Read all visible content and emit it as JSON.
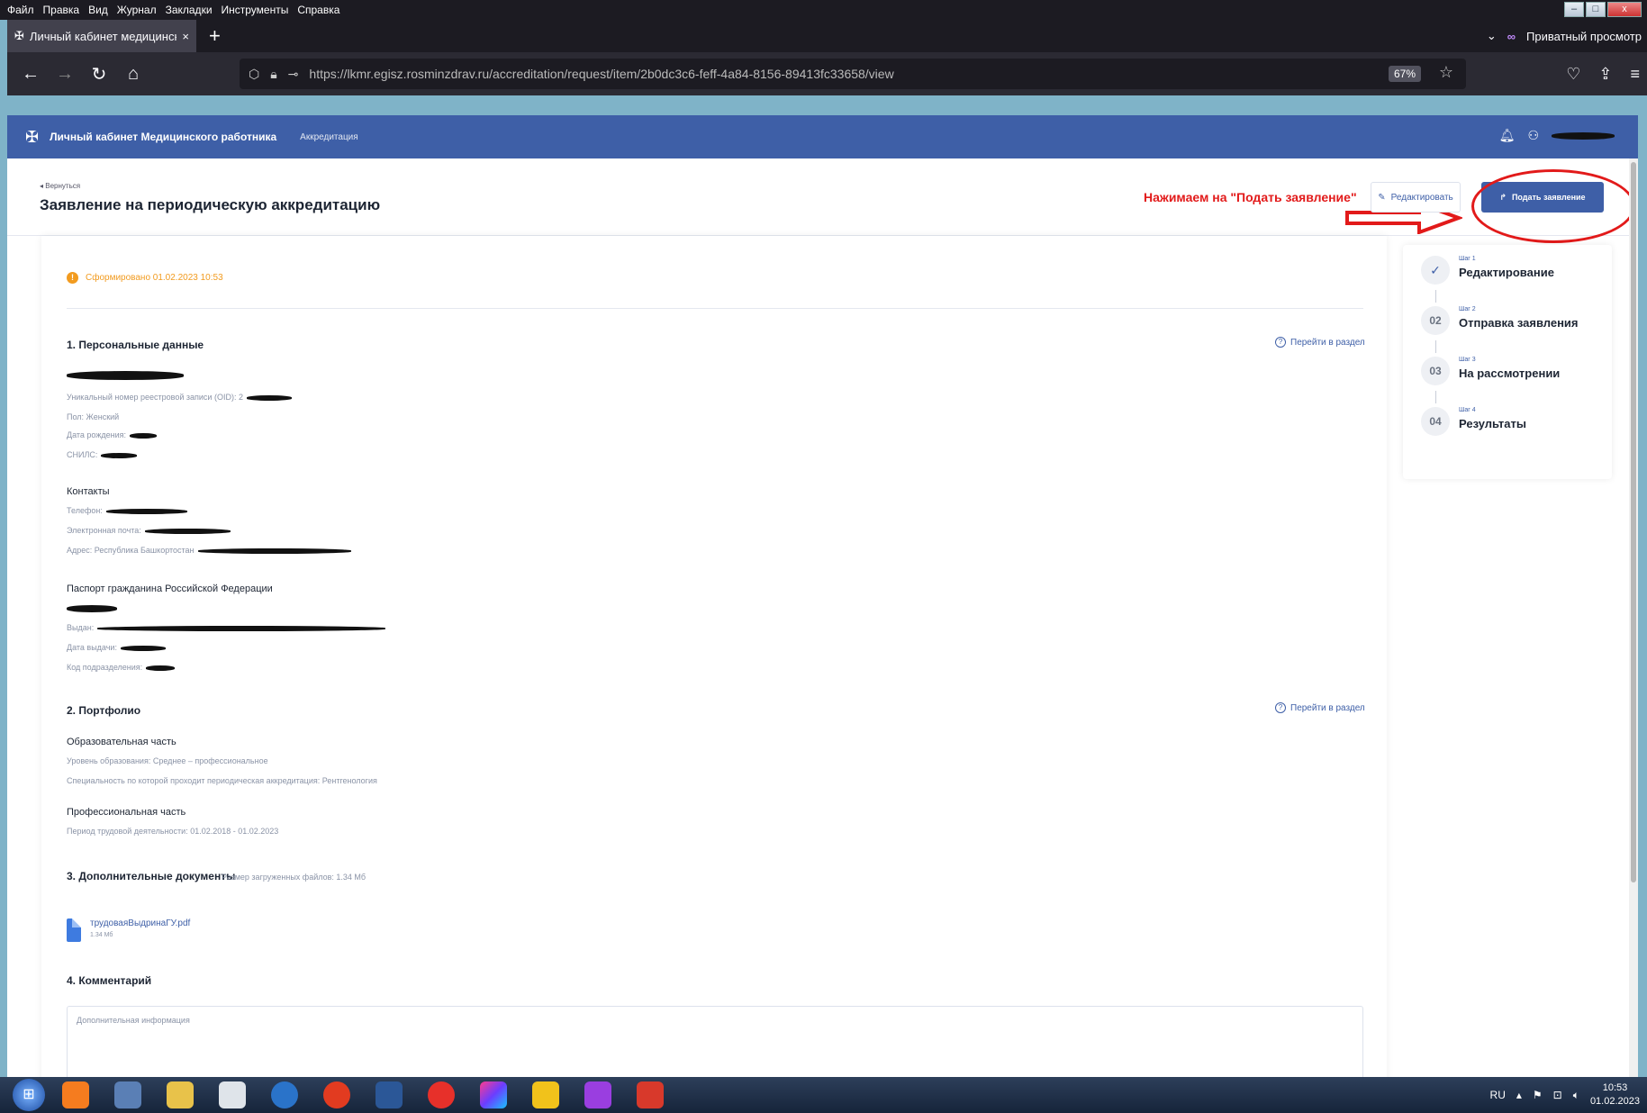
{
  "menubar": {
    "items": [
      "Файл",
      "Правка",
      "Вид",
      "Журнал",
      "Закладки",
      "Инструменты",
      "Справка"
    ]
  },
  "tab": {
    "title": "Личный кабинет медицинског",
    "close": "×",
    "new": "+"
  },
  "tabbar_right": {
    "private_label": "Приватный просмотр"
  },
  "urlbar": {
    "url": "https://lkmr.egisz.rosminzdrav.ru/accreditation/request/item/2b0dc3c6-feff-4a84-8156-89413fc33658/view",
    "zoom": "67%"
  },
  "app_header": {
    "name": "Личный кабинет Медицинского работника",
    "section": "Аккредитация"
  },
  "page": {
    "back_label": "Вернуться",
    "title": "Заявление на периодическую аккредитацию",
    "annotation": "Нажимаем на \"Подать заявление\"",
    "edit_button": "Редактировать",
    "submit_button": "Подать заявление"
  },
  "status": {
    "text": "Сформировано 01.02.2023 10:53"
  },
  "sections": {
    "personal": {
      "title": "1. Персональные данные",
      "goto": "Перейти в раздел",
      "oid": "Уникальный номер реестровой записи (OID): 2",
      "gender": "Пол: Женский",
      "birth": "Дата рождения:",
      "snils": "СНИЛС:",
      "contacts_title": "Контакты",
      "phone": "Телефон:",
      "email": "Электронная почта:",
      "address": "Адрес: Республика Башкортостан",
      "passport_title": "Паспорт гражданина Российской Федерации",
      "issued_by": "Выдан:",
      "issue_date": "Дата выдачи:",
      "division_code": "Код подразделения:"
    },
    "portfolio": {
      "title": "2. Портфолио",
      "goto": "Перейти в раздел",
      "edu_title": "Образовательная часть",
      "edu_level": "Уровень образования: Среднее – профессиональное",
      "specialty": "Специальность по которой проходит периодическая аккредитация: Рентгенология",
      "prof_title": "Профессиональная часть",
      "work_period": "Период трудовой деятельности: 01.02.2018 - 01.02.2023"
    },
    "documents": {
      "title": "3. Дополнительные документы",
      "size_info": "Размер загруженных файлов: 1.34 Мб",
      "file_name": "трудоваяВыдринаГУ.pdf",
      "file_size": "1.34 Мб"
    },
    "comment": {
      "title": "4. Комментарий",
      "placeholder": "Дополнительная информация"
    }
  },
  "steps": [
    {
      "num": "Шаг 1",
      "title": "Редактирование",
      "badge": "✓"
    },
    {
      "num": "Шаг 2",
      "title": "Отправка заявления",
      "badge": "02"
    },
    {
      "num": "Шаг 3",
      "title": "На рассмотрении",
      "badge": "03"
    },
    {
      "num": "Шаг 4",
      "title": "Результаты",
      "badge": "04"
    }
  ],
  "taskbar": {
    "lang": "RU",
    "time": "10:53",
    "date": "01.02.2023"
  },
  "colors": {
    "brand": "#3e5fa7",
    "annotation": "#e21a1a",
    "status": "#f29b1f"
  }
}
